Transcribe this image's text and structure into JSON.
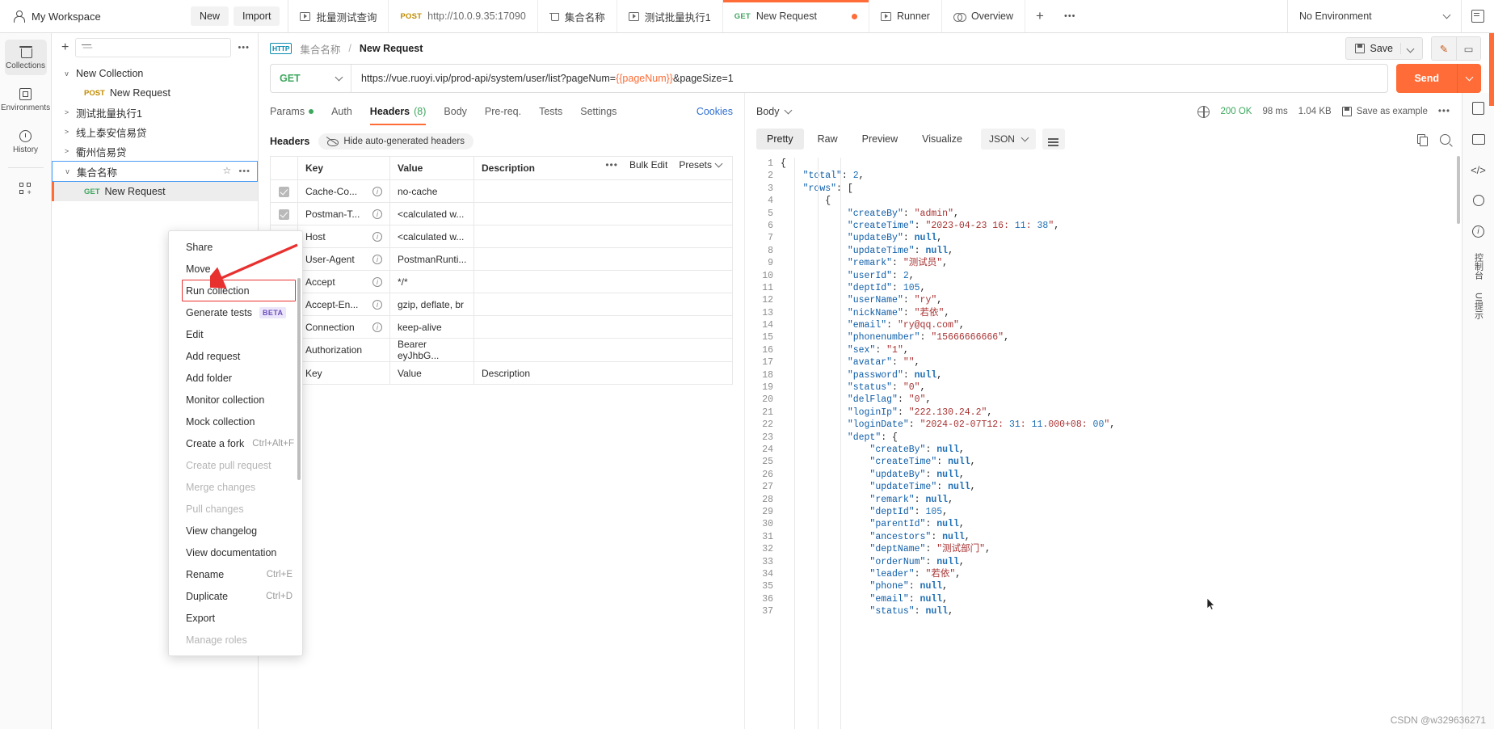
{
  "topbar": {
    "workspace": "My Workspace",
    "new_label": "New",
    "import_label": "Import",
    "tabs": [
      {
        "label": "批量测试查询",
        "icon": "runner-icon",
        "method": "",
        "active": false
      },
      {
        "label": "http://10.0.9.35:17090",
        "icon": "",
        "method": "POST",
        "active": false
      },
      {
        "label": "集合名称",
        "icon": "collection-icon",
        "method": "",
        "active": false
      },
      {
        "label": "测试批量执行1",
        "icon": "runner-icon",
        "method": "",
        "active": false
      },
      {
        "label": "New Request",
        "icon": "",
        "method": "GET",
        "active": true,
        "unsaved": true
      },
      {
        "label": "Runner",
        "icon": "runner-icon",
        "method": "",
        "active": false
      },
      {
        "label": "Overview",
        "icon": "overview-icon",
        "method": "",
        "active": false
      }
    ],
    "add_tab": "+",
    "more_tabs": "•••",
    "environment": "No Environment"
  },
  "rail": {
    "items": [
      {
        "label": "Collections",
        "icon": "collections-icon",
        "active": true
      },
      {
        "label": "Environments",
        "icon": "environments-icon",
        "active": false
      },
      {
        "label": "History",
        "icon": "history-icon",
        "active": false
      }
    ],
    "apps_icon": "new-app-icon"
  },
  "sidebar": {
    "add_icon": "plus-icon",
    "filter_icon": "filter-icon",
    "more_icon": "more-icon",
    "tree": [
      {
        "label": "New Collection",
        "caret": "v",
        "level": 0,
        "method": "",
        "selected": false
      },
      {
        "label": "New Request",
        "caret": "",
        "level": 1,
        "method": "POST",
        "selected": false
      },
      {
        "label": "测试批量执行1",
        "caret": ">",
        "level": 0,
        "method": "",
        "selected": false
      },
      {
        "label": "线上泰安信易贷",
        "caret": ">",
        "level": 0,
        "method": "",
        "selected": false
      },
      {
        "label": "衢州信易贷",
        "caret": ">",
        "level": 0,
        "method": "",
        "selected": false
      },
      {
        "label": "集合名称",
        "caret": "v",
        "level": 0,
        "method": "",
        "selected": true
      },
      {
        "label": "New Request",
        "caret": "",
        "level": 1,
        "method": "GET",
        "selected": false,
        "highlight": true
      }
    ]
  },
  "context_menu": {
    "items": [
      {
        "label": "Share",
        "shortcut": "",
        "disabled": false,
        "badge": "",
        "boxed": false
      },
      {
        "label": "Move",
        "shortcut": "",
        "disabled": false,
        "badge": "",
        "boxed": false
      },
      {
        "label": "Run collection",
        "shortcut": "",
        "disabled": false,
        "badge": "",
        "boxed": true
      },
      {
        "label": "Generate tests",
        "shortcut": "",
        "disabled": false,
        "badge": "BETA",
        "boxed": false
      },
      {
        "label": "Edit",
        "shortcut": "",
        "disabled": false,
        "badge": "",
        "boxed": false
      },
      {
        "label": "Add request",
        "shortcut": "",
        "disabled": false,
        "badge": "",
        "boxed": false
      },
      {
        "label": "Add folder",
        "shortcut": "",
        "disabled": false,
        "badge": "",
        "boxed": false
      },
      {
        "label": "Monitor collection",
        "shortcut": "",
        "disabled": false,
        "badge": "",
        "boxed": false
      },
      {
        "label": "Mock collection",
        "shortcut": "",
        "disabled": false,
        "badge": "",
        "boxed": false
      },
      {
        "label": "Create a fork",
        "shortcut": "Ctrl+Alt+F",
        "disabled": false,
        "badge": "",
        "boxed": false
      },
      {
        "label": "Create pull request",
        "shortcut": "",
        "disabled": true,
        "badge": "",
        "boxed": false
      },
      {
        "label": "Merge changes",
        "shortcut": "",
        "disabled": true,
        "badge": "",
        "boxed": false
      },
      {
        "label": "Pull changes",
        "shortcut": "",
        "disabled": true,
        "badge": "",
        "boxed": false
      },
      {
        "label": "View changelog",
        "shortcut": "",
        "disabled": false,
        "badge": "",
        "boxed": false
      },
      {
        "label": "View documentation",
        "shortcut": "",
        "disabled": false,
        "badge": "",
        "boxed": false
      },
      {
        "label": "Rename",
        "shortcut": "Ctrl+E",
        "disabled": false,
        "badge": "",
        "boxed": false
      },
      {
        "label": "Duplicate",
        "shortcut": "Ctrl+D",
        "disabled": false,
        "badge": "",
        "boxed": false
      },
      {
        "label": "Export",
        "shortcut": "",
        "disabled": false,
        "badge": "",
        "boxed": false
      },
      {
        "label": "Manage roles",
        "shortcut": "",
        "disabled": true,
        "badge": "",
        "boxed": false
      }
    ]
  },
  "request": {
    "breadcrumb_icon": "HTTP",
    "breadcrumb_collection": "集合名称",
    "breadcrumb_sep": "/",
    "breadcrumb_name": "New Request",
    "save_label": "Save",
    "method": "GET",
    "url_prefix": "https://vue.ruoyi.vip/prod-api/system/user/list?pageNum=",
    "url_var": "{{pageNum}}",
    "url_suffix": "&pageSize=1",
    "send_label": "Send",
    "tabs": [
      {
        "label": "Params",
        "dot": true,
        "count": "",
        "active": false
      },
      {
        "label": "Auth",
        "dot": false,
        "count": "",
        "active": false
      },
      {
        "label": "Headers",
        "dot": false,
        "count": "(8)",
        "active": true
      },
      {
        "label": "Body",
        "dot": false,
        "count": "",
        "active": false
      },
      {
        "label": "Pre-req.",
        "dot": false,
        "count": "",
        "active": false
      },
      {
        "label": "Tests",
        "dot": false,
        "count": "",
        "active": false
      },
      {
        "label": "Settings",
        "dot": false,
        "count": "",
        "active": false
      }
    ],
    "cookies_label": "Cookies",
    "headers_title": "Headers",
    "hide_auto_label": "Hide auto-generated headers",
    "bulk_edit_label": "Bulk Edit",
    "presets_label": "Presets",
    "table_more": "•••",
    "columns": [
      "Key",
      "Value",
      "Description"
    ],
    "rows": [
      {
        "checked": true,
        "dim": true,
        "key": "Cache-Co...",
        "value": "no-cache",
        "desc": ""
      },
      {
        "checked": true,
        "dim": true,
        "key": "Postman-T...",
        "value": "<calculated w...",
        "desc": ""
      },
      {
        "checked": true,
        "dim": false,
        "key": "Host",
        "value": "<calculated w...",
        "desc": ""
      },
      {
        "checked": true,
        "dim": false,
        "key": "User-Agent",
        "value": "PostmanRunti...",
        "desc": ""
      },
      {
        "checked": true,
        "dim": false,
        "key": "Accept",
        "value": "*/*",
        "desc": ""
      },
      {
        "checked": true,
        "dim": false,
        "key": "Accept-En...",
        "value": "gzip, deflate, br",
        "desc": ""
      },
      {
        "checked": true,
        "dim": false,
        "key": "Connection",
        "value": "keep-alive",
        "desc": ""
      },
      {
        "checked": true,
        "dim": false,
        "key": "Authorization",
        "value": "Bearer eyJhbG...",
        "desc": ""
      }
    ],
    "placeholder_row": [
      "Key",
      "Value",
      "Description"
    ]
  },
  "response": {
    "body_label": "Body",
    "status": "200 OK",
    "time": "98 ms",
    "size": "1.04 KB",
    "save_example_label": "Save as example",
    "more": "•••",
    "view_tabs": [
      "Pretty",
      "Raw",
      "Preview",
      "Visualize"
    ],
    "active_view": "Pretty",
    "format": "JSON",
    "json_lines": [
      {
        "n": 1,
        "text": "{"
      },
      {
        "n": 2,
        "text": "    \"total\": 2,"
      },
      {
        "n": 3,
        "text": "    \"rows\": ["
      },
      {
        "n": 4,
        "text": "        {"
      },
      {
        "n": 5,
        "text": "            \"createBy\": \"admin\","
      },
      {
        "n": 6,
        "text": "            \"createTime\": \"2023-04-23 16:11:38\","
      },
      {
        "n": 7,
        "text": "            \"updateBy\": null,"
      },
      {
        "n": 8,
        "text": "            \"updateTime\": null,"
      },
      {
        "n": 9,
        "text": "            \"remark\": \"测试员\","
      },
      {
        "n": 10,
        "text": "            \"userId\": 2,"
      },
      {
        "n": 11,
        "text": "            \"deptId\": 105,"
      },
      {
        "n": 12,
        "text": "            \"userName\": \"ry\","
      },
      {
        "n": 13,
        "text": "            \"nickName\": \"若依\","
      },
      {
        "n": 14,
        "text": "            \"email\": \"ry@qq.com\","
      },
      {
        "n": 15,
        "text": "            \"phonenumber\": \"15666666666\","
      },
      {
        "n": 16,
        "text": "            \"sex\": \"1\","
      },
      {
        "n": 17,
        "text": "            \"avatar\": \"\","
      },
      {
        "n": 18,
        "text": "            \"password\": null,"
      },
      {
        "n": 19,
        "text": "            \"status\": \"0\","
      },
      {
        "n": 20,
        "text": "            \"delFlag\": \"0\","
      },
      {
        "n": 21,
        "text": "            \"loginIp\": \"222.130.24.2\","
      },
      {
        "n": 22,
        "text": "            \"loginDate\": \"2024-02-07T12:31:11.000+08:00\","
      },
      {
        "n": 23,
        "text": "            \"dept\": {"
      },
      {
        "n": 24,
        "text": "                \"createBy\": null,"
      },
      {
        "n": 25,
        "text": "                \"createTime\": null,"
      },
      {
        "n": 26,
        "text": "                \"updateBy\": null,"
      },
      {
        "n": 27,
        "text": "                \"updateTime\": null,"
      },
      {
        "n": 28,
        "text": "                \"remark\": null,"
      },
      {
        "n": 29,
        "text": "                \"deptId\": 105,"
      },
      {
        "n": 30,
        "text": "                \"parentId\": null,"
      },
      {
        "n": 31,
        "text": "                \"ancestors\": null,"
      },
      {
        "n": 32,
        "text": "                \"deptName\": \"测试部门\","
      },
      {
        "n": 33,
        "text": "                \"orderNum\": null,"
      },
      {
        "n": 34,
        "text": "                \"leader\": \"若依\","
      },
      {
        "n": 35,
        "text": "                \"phone\": null,"
      },
      {
        "n": 36,
        "text": "                \"email\": null,"
      },
      {
        "n": 37,
        "text": "                \"status\": null,"
      }
    ]
  },
  "right_rail": {
    "labels": [
      "控制台",
      "UI提示"
    ]
  },
  "watermark": "CSDN @w329636271"
}
